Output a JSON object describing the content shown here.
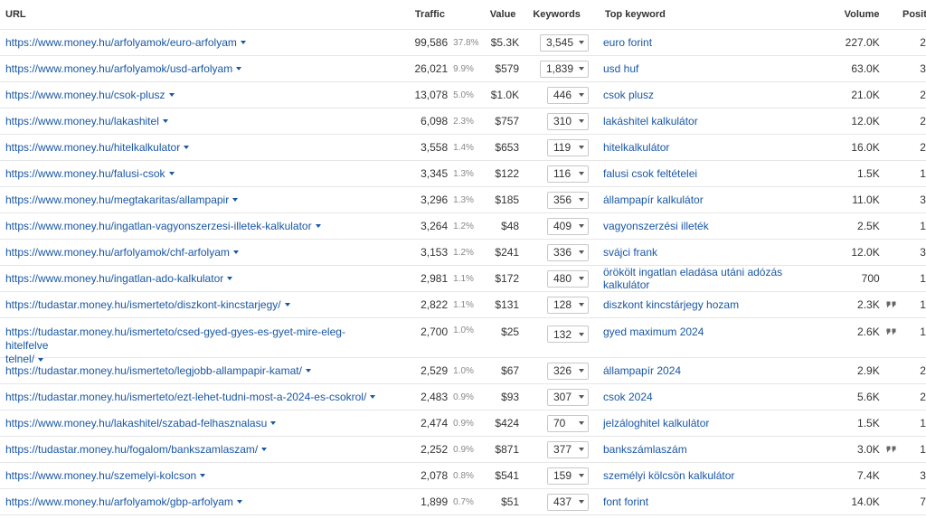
{
  "headers": {
    "url": "URL",
    "traffic": "Traffic",
    "value": "Value",
    "keywords": "Keywords",
    "top_keyword": "Top keyword",
    "volume": "Volume",
    "position": "Position"
  },
  "rows": [
    {
      "url": "https://www.money.hu/arfolyamok/euro-arfolyam",
      "traffic": "99,586",
      "pct": "37.8%",
      "value": "$5.3K",
      "keywords": "3,545",
      "top_keyword": "euro forint",
      "volume": "227.0K",
      "position": "2",
      "quote_icon": false
    },
    {
      "url": "https://www.money.hu/arfolyamok/usd-arfolyam",
      "traffic": "26,021",
      "pct": "9.9%",
      "value": "$579",
      "keywords": "1,839",
      "top_keyword": "usd huf",
      "volume": "63.0K",
      "position": "3",
      "quote_icon": false
    },
    {
      "url": "https://www.money.hu/csok-plusz",
      "traffic": "13,078",
      "pct": "5.0%",
      "value": "$1.0K",
      "keywords": "446",
      "top_keyword": "csok plusz",
      "volume": "21.0K",
      "position": "2",
      "quote_icon": false
    },
    {
      "url": "https://www.money.hu/lakashitel",
      "traffic": "6,098",
      "pct": "2.3%",
      "value": "$757",
      "keywords": "310",
      "top_keyword": "lakáshitel kalkulátor",
      "volume": "12.0K",
      "position": "2",
      "quote_icon": false
    },
    {
      "url": "https://www.money.hu/hitelkalkulator",
      "traffic": "3,558",
      "pct": "1.4%",
      "value": "$653",
      "keywords": "119",
      "top_keyword": "hitelkalkulátor",
      "volume": "16.0K",
      "position": "2",
      "quote_icon": false
    },
    {
      "url": "https://www.money.hu/falusi-csok",
      "traffic": "3,345",
      "pct": "1.3%",
      "value": "$122",
      "keywords": "116",
      "top_keyword": "falusi csok feltételei",
      "volume": "1.5K",
      "position": "1",
      "quote_icon": false
    },
    {
      "url": "https://www.money.hu/megtakaritas/allampapir",
      "traffic": "3,296",
      "pct": "1.3%",
      "value": "$185",
      "keywords": "356",
      "top_keyword": "állampapír kalkulátor",
      "volume": "11.0K",
      "position": "3",
      "quote_icon": false
    },
    {
      "url": "https://www.money.hu/ingatlan-vagyonszerzesi-illetek-kalkulator",
      "traffic": "3,264",
      "pct": "1.2%",
      "value": "$48",
      "keywords": "409",
      "top_keyword": "vagyonszerzési illeték",
      "volume": "2.5K",
      "position": "1",
      "quote_icon": false
    },
    {
      "url": "https://www.money.hu/arfolyamok/chf-arfolyam",
      "traffic": "3,153",
      "pct": "1.2%",
      "value": "$241",
      "keywords": "336",
      "top_keyword": "svájci frank",
      "volume": "12.0K",
      "position": "3",
      "quote_icon": false
    },
    {
      "url": "https://www.money.hu/ingatlan-ado-kalkulator",
      "traffic": "2,981",
      "pct": "1.1%",
      "value": "$172",
      "keywords": "480",
      "top_keyword": "örökölt ingatlan eladása utáni adózás kalkulátor",
      "volume": "700",
      "position": "1",
      "quote_icon": false
    },
    {
      "url": "https://tudastar.money.hu/ismerteto/diszkont-kincstarjegy/",
      "traffic": "2,822",
      "pct": "1.1%",
      "value": "$131",
      "keywords": "128",
      "top_keyword": "diszkont kincstárjegy hozam",
      "volume": "2.3K",
      "position": "1",
      "quote_icon": true
    },
    {
      "url": "https://tudastar.money.hu/ismerteto/csed-gyed-gyes-es-gyet-mire-eleg-hitelfelvetelnel/",
      "url_line1": "https://tudastar.money.hu/ismerteto/csed-gyed-gyes-es-gyet-mire-eleg-hitelfelve",
      "url_line2": "telnel/",
      "traffic": "2,700",
      "pct": "1.0%",
      "value": "$25",
      "keywords": "132",
      "top_keyword": "gyed maximum 2024",
      "volume": "2.6K",
      "position": "1",
      "quote_icon": true
    },
    {
      "url": "https://tudastar.money.hu/ismerteto/legjobb-allampapir-kamat/",
      "traffic": "2,529",
      "pct": "1.0%",
      "value": "$67",
      "keywords": "326",
      "top_keyword": "állampapír 2024",
      "volume": "2.9K",
      "position": "2",
      "quote_icon": false
    },
    {
      "url": "https://tudastar.money.hu/ismerteto/ezt-lehet-tudni-most-a-2024-es-csokrol/",
      "traffic": "2,483",
      "pct": "0.9%",
      "value": "$93",
      "keywords": "307",
      "top_keyword": "csok 2024",
      "volume": "5.6K",
      "position": "2",
      "quote_icon": false
    },
    {
      "url": "https://www.money.hu/lakashitel/szabad-felhasznalasu",
      "traffic": "2,474",
      "pct": "0.9%",
      "value": "$424",
      "keywords": "70",
      "top_keyword": "jelzáloghitel kalkulátor",
      "volume": "1.5K",
      "position": "1",
      "quote_icon": false
    },
    {
      "url": "https://tudastar.money.hu/fogalom/bankszamlaszam/",
      "traffic": "2,252",
      "pct": "0.9%",
      "value": "$871",
      "keywords": "377",
      "top_keyword": "bankszámlaszám",
      "volume": "3.0K",
      "position": "1",
      "quote_icon": true
    },
    {
      "url": "https://www.money.hu/szemelyi-kolcson",
      "traffic": "2,078",
      "pct": "0.8%",
      "value": "$541",
      "keywords": "159",
      "top_keyword": "személyi kölcsön kalkulátor",
      "volume": "7.4K",
      "position": "3",
      "quote_icon": false
    },
    {
      "url": "https://www.money.hu/arfolyamok/gbp-arfolyam",
      "traffic": "1,899",
      "pct": "0.7%",
      "value": "$51",
      "keywords": "437",
      "top_keyword": "font forint",
      "volume": "14.0K",
      "position": "7",
      "quote_icon": false
    }
  ]
}
